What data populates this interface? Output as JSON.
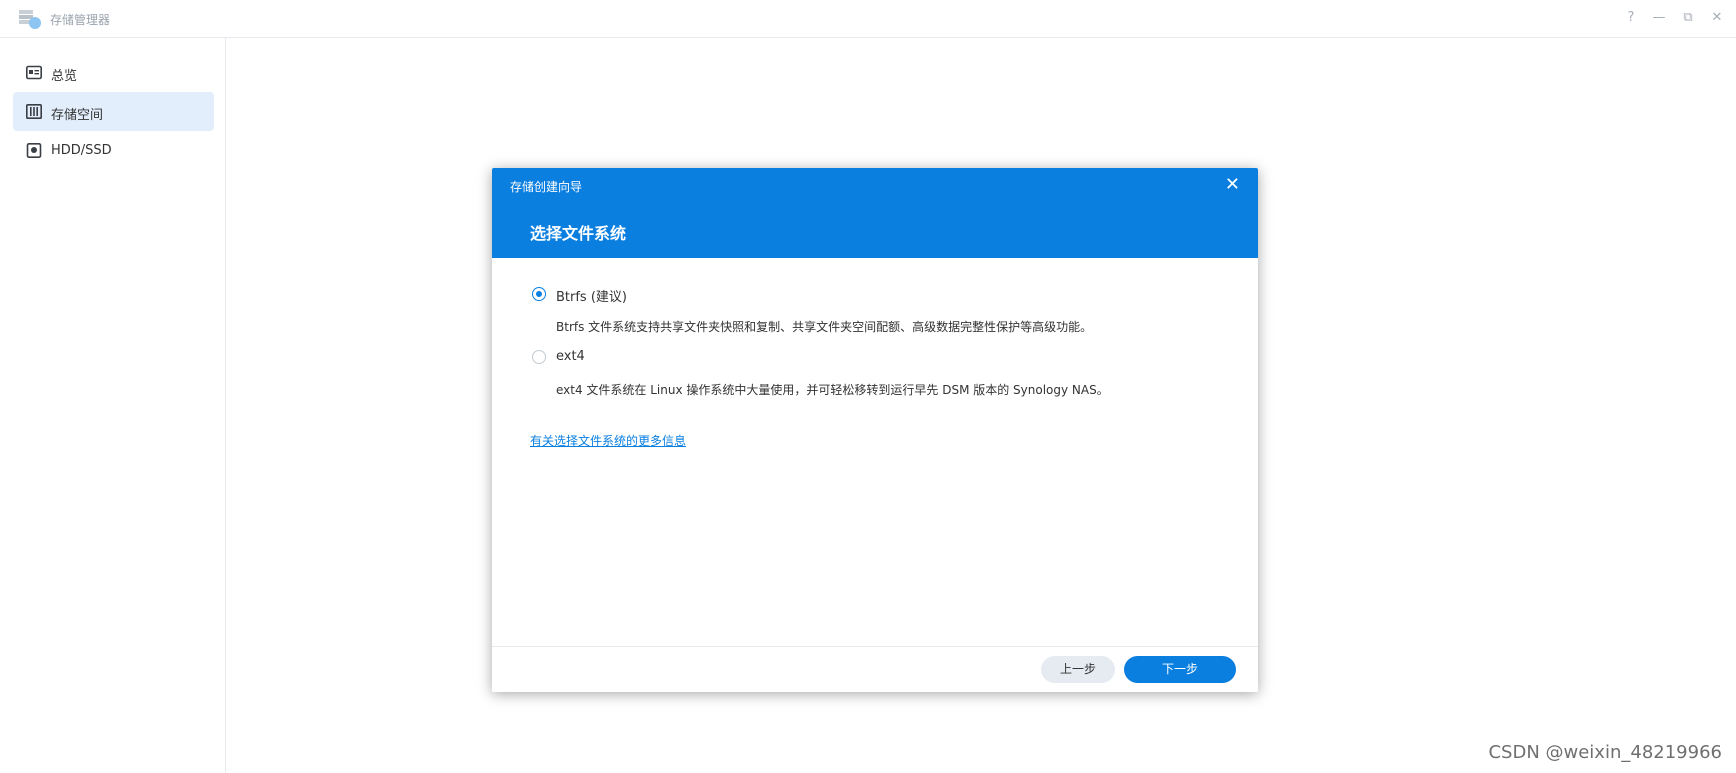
{
  "window": {
    "title": "存储管理器",
    "controls": [
      "?",
      "—",
      "⧉",
      "✕"
    ]
  },
  "sidebar": {
    "items": [
      {
        "label": "总览",
        "icon": "overview-icon",
        "active": false
      },
      {
        "label": "存储空间",
        "icon": "storage-icon",
        "active": true
      },
      {
        "label": "HDD/SSD",
        "icon": "disk-icon",
        "active": false
      }
    ]
  },
  "dialog": {
    "title": "存储创建向导",
    "step_title": "选择文件系统",
    "close_symbol": "✕",
    "options": [
      {
        "label": "Btrfs (建议)",
        "description": "Btrfs 文件系统支持共享文件夹快照和复制、共享文件夹空间配额、高级数据完整性保护等高级功能。",
        "checked": true
      },
      {
        "label": "ext4",
        "description": "ext4 文件系统在 Linux 操作系统中大量使用，并可轻松移转到运行早先 DSM 版本的 Synology NAS。",
        "checked": false
      }
    ],
    "more_info_link": "有关选择文件系统的更多信息",
    "prev_button": "上一步",
    "next_button": "下一步"
  },
  "watermark": "CSDN @weixin_48219966",
  "colors": {
    "accent": "#0a7fe0",
    "sidebar_active": "#e3eefc"
  }
}
